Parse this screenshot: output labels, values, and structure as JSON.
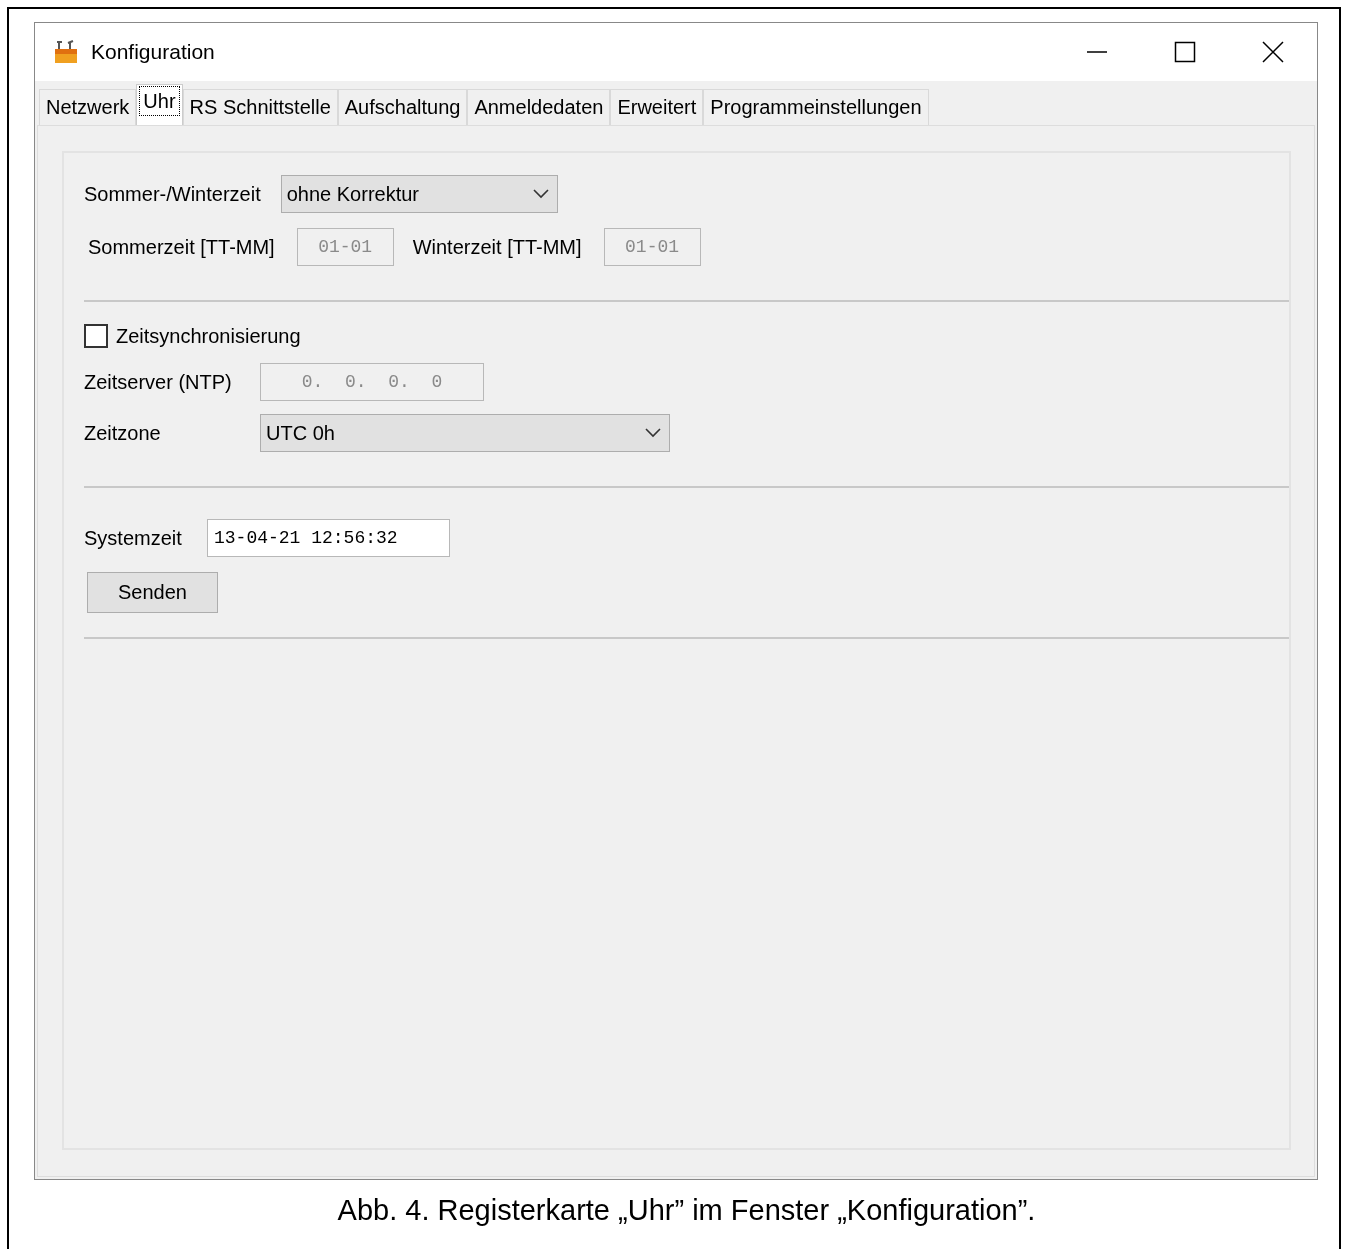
{
  "window": {
    "title": "Konfiguration"
  },
  "tabs": [
    {
      "label": "Netzwerk",
      "selected": false
    },
    {
      "label": "Uhr",
      "selected": true
    },
    {
      "label": "RS Schnittstelle",
      "selected": false
    },
    {
      "label": "Aufschaltung",
      "selected": false
    },
    {
      "label": "Anmeldedaten",
      "selected": false
    },
    {
      "label": "Erweitert",
      "selected": false
    },
    {
      "label": "Programmeinstellungen",
      "selected": false
    }
  ],
  "dst": {
    "label": "Sommer-/Winterzeit",
    "value": "ohne Korrektur"
  },
  "dst_dates": [
    {
      "label": "Sommerzeit [TT-MM]",
      "value": "01-01",
      "disabled": true
    },
    {
      "label": "Winterzeit [TT-MM]",
      "value": "01-01",
      "disabled": true
    }
  ],
  "time_sync": {
    "label": "Zeitsynchronisierung",
    "checked": false
  },
  "ntp_server": {
    "label": "Zeitserver (NTP)",
    "value": "0.  0.  0.  0",
    "disabled": true
  },
  "timezone": {
    "label": "Zeitzone",
    "value": "UTC 0h"
  },
  "system_time": {
    "label": "Systemzeit",
    "value": "13-04-21 12:56:32",
    "disabled": false
  },
  "send_button": "Senden",
  "caption": "Abb. 4. Registerkarte „Uhr” im Fenster „Konfiguration”."
}
